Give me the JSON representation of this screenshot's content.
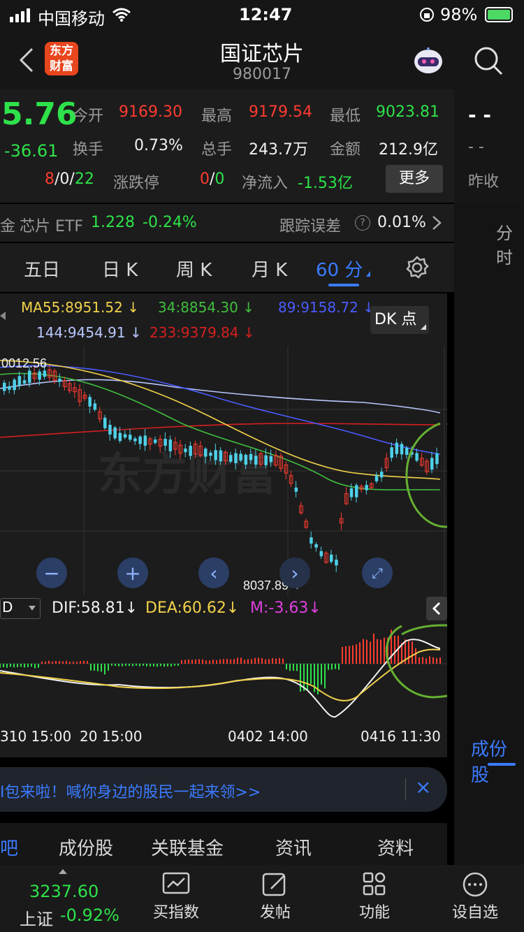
{
  "status": {
    "carrier": "中国移动",
    "time": "12:47",
    "battery": "98%"
  },
  "header": {
    "logo_text_1": "东方",
    "logo_text_2": "财富",
    "title": "国证芯片",
    "code": "980017"
  },
  "quote": {
    "price": "5.76",
    "change": "-36.61",
    "open_label": "今开",
    "open": "9169.30",
    "high_label": "最高",
    "high": "9179.54",
    "low_label": "最低",
    "low": "9023.81",
    "turnover_label": "换手",
    "turnover": "0.73%",
    "volume_label": "总手",
    "volume": "243.7万",
    "amount_label": "金额",
    "amount": "212.9亿",
    "adv": "8",
    "flat": "0",
    "dec": "22",
    "limit_label": "涨跌停",
    "limit_up": "0",
    "limit_down": "0",
    "netflow_label": "净流入",
    "netflow": "-1.53亿",
    "more_label": "更多",
    "right_dash1": "- -",
    "right_dash2": "- -",
    "prev_close_label": "昨收"
  },
  "etf": {
    "prefix": "金",
    "name": "芯片 ETF",
    "price": "1.228",
    "change": "-0.24%",
    "error_label": "跟踪误差",
    "help_icon": "?",
    "error": "0.01%",
    "side_label": "分时"
  },
  "tabs": [
    "五日",
    "日 K",
    "周 K",
    "月 K",
    "60 分"
  ],
  "ma": {
    "ma55": "MA55:8951.52",
    "ma34": "34:8854.30",
    "ma89": "89:9158.72",
    "ma144": "144:9454.91",
    "ma233": "233:9379.84",
    "dk_label": "DK 点",
    "arrow": "↓"
  },
  "chart_labels": {
    "high_mark": "0012.56",
    "low_mark": "8037.89→",
    "watermark": "东方财富"
  },
  "macd": {
    "selector": "D",
    "dif": "DIF:58.81",
    "dea": "DEA:60.62",
    "m": "M:-3.63",
    "arrow": "↓"
  },
  "time_axis": [
    "310 15:00",
    "20 15:00",
    "0402 14:00",
    "0416 11:30"
  ],
  "right_tab": "成份股",
  "banner": {
    "text": "I包来啦！喊你身边的股民一起来领>>",
    "close": "×"
  },
  "subtabs": [
    "吧",
    "成份股",
    "关联基金",
    "资讯",
    "资料"
  ],
  "bottom": {
    "index_value": "3237.60",
    "index_name": "上证",
    "index_change": "-0.92%",
    "items": [
      "买指数",
      "发帖",
      "功能",
      "设自选"
    ]
  },
  "colors": {
    "up": "#ff3b30",
    "down": "#2ee24a",
    "accent": "#3b7bff",
    "ma55": "#f2d24b",
    "ma34": "#3fbf3f",
    "ma89": "#4a5cff",
    "ma144": "#b8c8ff",
    "ma233": "#d61f1f"
  }
}
